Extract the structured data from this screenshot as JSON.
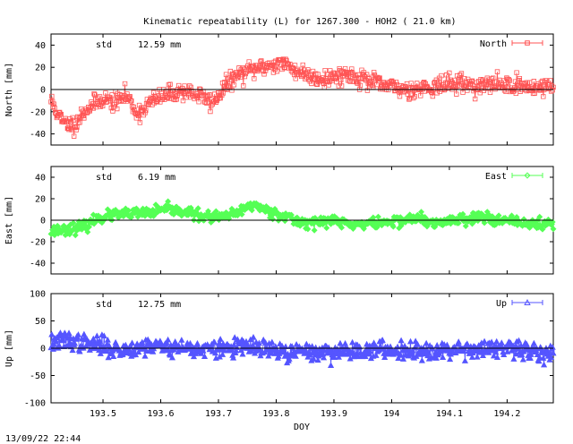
{
  "figure": {
    "title": "Kinematic repeatability (L) for 1267.300 - HOH2  ( 21.0 km)",
    "xlabel": "DOY",
    "timestamp": "13/09/22 22:44"
  },
  "chart_data": [
    {
      "type": "line",
      "title": "Kinematic repeatability (L) for 1267.300 - HOH2  ( 21.0 km)",
      "ylabel": "North [mm]",
      "xlabel": "",
      "series_name": "North",
      "color": "#ff5555",
      "marker": "square",
      "stat_label": "std",
      "stat_value": "12.59 mm",
      "xlim": [
        193.41,
        194.28
      ],
      "ylim": [
        -50,
        50
      ],
      "yticks": [
        -40,
        -20,
        0,
        20,
        40
      ],
      "knots": [
        [
          193.41,
          -10
        ],
        [
          193.43,
          -30
        ],
        [
          193.45,
          -32
        ],
        [
          193.47,
          -18
        ],
        [
          193.5,
          -8
        ],
        [
          193.52,
          -12
        ],
        [
          193.54,
          -5
        ],
        [
          193.56,
          -22
        ],
        [
          193.58,
          -12
        ],
        [
          193.61,
          -5
        ],
        [
          193.64,
          -1
        ],
        [
          193.67,
          -6
        ],
        [
          193.69,
          -12
        ],
        [
          193.71,
          2
        ],
        [
          193.73,
          12
        ],
        [
          193.76,
          18
        ],
        [
          193.79,
          22
        ],
        [
          193.81,
          24
        ],
        [
          193.83,
          18
        ],
        [
          193.86,
          12
        ],
        [
          193.89,
          10
        ],
        [
          193.92,
          14
        ],
        [
          193.95,
          10
        ],
        [
          193.98,
          4
        ],
        [
          194.0,
          2
        ],
        [
          194.03,
          0
        ],
        [
          194.06,
          2
        ],
        [
          194.09,
          4
        ],
        [
          194.12,
          6
        ],
        [
          194.15,
          3
        ],
        [
          194.18,
          5
        ],
        [
          194.21,
          4
        ],
        [
          194.24,
          2
        ],
        [
          194.27,
          3
        ],
        [
          194.28,
          2
        ]
      ],
      "noise": 4,
      "seed": 11
    },
    {
      "type": "line",
      "ylabel": "East [mm]",
      "series_name": "East",
      "color": "#55ff55",
      "marker": "diamond",
      "stat_label": "std",
      "stat_value": "6.19 mm",
      "xlim": [
        193.41,
        194.28
      ],
      "ylim": [
        -50,
        50
      ],
      "yticks": [
        -40,
        -20,
        0,
        20,
        40
      ],
      "knots": [
        [
          193.41,
          -10
        ],
        [
          193.44,
          -8
        ],
        [
          193.47,
          -6
        ],
        [
          193.49,
          2
        ],
        [
          193.52,
          5
        ],
        [
          193.55,
          6
        ],
        [
          193.58,
          7
        ],
        [
          193.61,
          10
        ],
        [
          193.64,
          8
        ],
        [
          193.67,
          4
        ],
        [
          193.7,
          2
        ],
        [
          193.73,
          6
        ],
        [
          193.76,
          15
        ],
        [
          193.78,
          10
        ],
        [
          193.81,
          5
        ],
        [
          193.84,
          -2
        ],
        [
          193.87,
          -2
        ],
        [
          193.9,
          0
        ],
        [
          193.93,
          -4
        ],
        [
          193.96,
          -3
        ],
        [
          193.99,
          -2
        ],
        [
          194.02,
          0
        ],
        [
          194.05,
          2
        ],
        [
          194.07,
          -4
        ],
        [
          194.1,
          0
        ],
        [
          194.13,
          2
        ],
        [
          194.16,
          4
        ],
        [
          194.19,
          -1
        ],
        [
          194.22,
          -2
        ],
        [
          194.25,
          -4
        ],
        [
          194.28,
          -3
        ]
      ],
      "noise": 2.5,
      "seed": 23
    },
    {
      "type": "line",
      "ylabel": "Up [mm]",
      "series_name": "Up",
      "color": "#5555ff",
      "marker": "triangle",
      "stat_label": "std",
      "stat_value": "12.75 mm",
      "xlim": [
        193.41,
        194.28
      ],
      "ylim": [
        -100,
        100
      ],
      "yticks": [
        -100,
        -50,
        0,
        50,
        100
      ],
      "xticks": [
        193.5,
        193.6,
        193.7,
        193.8,
        193.9,
        194,
        194.1,
        194.2
      ],
      "xticklabels": [
        "193.5",
        "193.6",
        "193.7",
        "193.8",
        "193.9",
        "194",
        "194.1",
        "194.2"
      ],
      "knots": [
        [
          193.41,
          10
        ],
        [
          193.44,
          15
        ],
        [
          193.47,
          8
        ],
        [
          193.5,
          5
        ],
        [
          193.53,
          -5
        ],
        [
          193.56,
          2
        ],
        [
          193.59,
          5
        ],
        [
          193.62,
          2
        ],
        [
          193.65,
          0
        ],
        [
          193.68,
          -2
        ],
        [
          193.71,
          0
        ],
        [
          193.74,
          3
        ],
        [
          193.77,
          0
        ],
        [
          193.8,
          -5
        ],
        [
          193.82,
          -10
        ],
        [
          193.85,
          -5
        ],
        [
          193.88,
          -8
        ],
        [
          193.91,
          -5
        ],
        [
          193.94,
          -4
        ],
        [
          193.97,
          -3
        ],
        [
          194.0,
          -4
        ],
        [
          194.03,
          -2
        ],
        [
          194.06,
          -5
        ],
        [
          194.09,
          -3
        ],
        [
          194.12,
          0
        ],
        [
          194.15,
          -2
        ],
        [
          194.18,
          -1
        ],
        [
          194.21,
          -3
        ],
        [
          194.24,
          -5
        ],
        [
          194.28,
          -8
        ]
      ],
      "noise": 8,
      "seed": 37
    }
  ]
}
